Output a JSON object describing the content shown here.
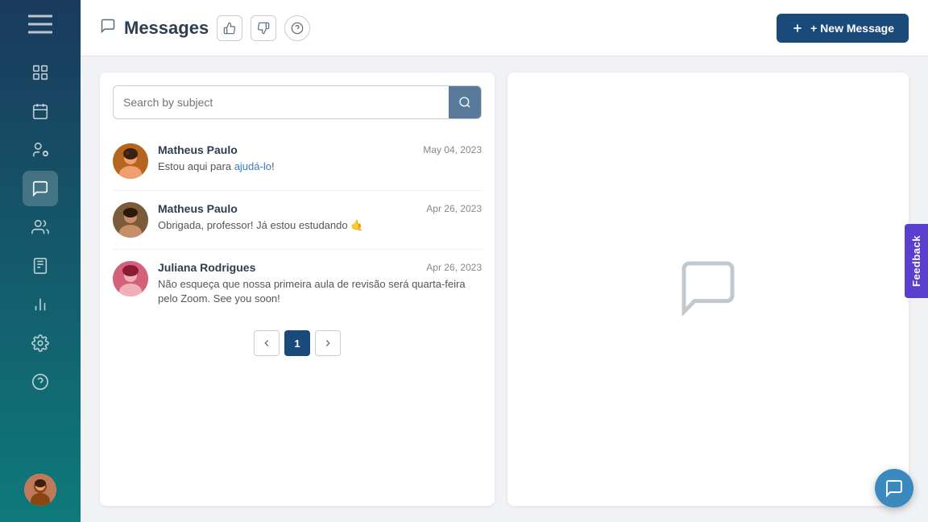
{
  "app": {
    "title": "Messages"
  },
  "header": {
    "title": "Messages",
    "new_message_label": "+ New Message",
    "thumbup_label": "thumb-up",
    "thumbdown_label": "thumb-down",
    "help_label": "help"
  },
  "search": {
    "placeholder": "Search by subject"
  },
  "messages": [
    {
      "id": 1,
      "name": "Matheus Paulo",
      "date": "May 04, 2023",
      "preview": "Estou aqui para ajudá-lo!",
      "preview_link": "ajudá-lo",
      "avatar_color": "#b5651d"
    },
    {
      "id": 2,
      "name": "Matheus Paulo",
      "date": "Apr 26, 2023",
      "preview": "Obrigada, professor! Já estou estudando 🤙",
      "avatar_color": "#7a5c3a"
    },
    {
      "id": 3,
      "name": "Juliana Rodrigues",
      "date": "Apr 26, 2023",
      "preview": "Não esqueça que nossa primeira aula de revisão será quarta-feira pelo Zoom. See you soon!",
      "avatar_color": "#d4607a"
    }
  ],
  "pagination": {
    "current_page": 1,
    "prev_label": "‹",
    "next_label": "›"
  },
  "feedback": {
    "label": "Feedback"
  },
  "sidebar": {
    "items": [
      {
        "name": "dashboard",
        "icon": "grid"
      },
      {
        "name": "calendar",
        "icon": "calendar"
      },
      {
        "name": "users-settings",
        "icon": "user-settings"
      },
      {
        "name": "messages",
        "icon": "messages",
        "active": true
      },
      {
        "name": "contacts",
        "icon": "contacts"
      },
      {
        "name": "notebook",
        "icon": "notebook"
      },
      {
        "name": "analytics",
        "icon": "analytics"
      },
      {
        "name": "settings",
        "icon": "settings"
      },
      {
        "name": "help",
        "icon": "help"
      }
    ]
  }
}
